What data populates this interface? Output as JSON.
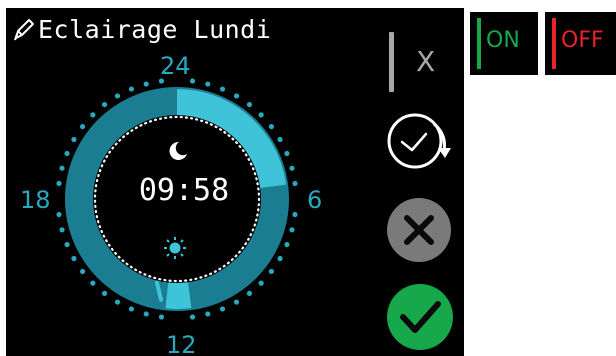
{
  "schedule": {
    "title": "Eclairage Lundi",
    "current_time": "09:58",
    "hour_labels": {
      "top": "24",
      "right": "6",
      "bottom": "12",
      "left": "18"
    },
    "on_arc_range_hours": [
      0,
      5.5
    ],
    "small_arc_range_hours": [
      11.5,
      12.4
    ]
  },
  "buttons": {
    "close_label": "X",
    "repeat_icon": "clock-repeat-icon",
    "cancel_icon": "x-circle-icon",
    "confirm_icon": "check-circle-icon"
  },
  "legend": {
    "on_label": "ON",
    "off_label": "OFF"
  },
  "colors": {
    "ring": "#1a7d92",
    "active_arc": "#3fc3d8",
    "text_teal": "#27a9c0",
    "cancel_button": "#7a7a7a",
    "confirm_button": "#16a84a",
    "on": "#16a84a",
    "off": "#e8232a",
    "background": "#000000"
  }
}
